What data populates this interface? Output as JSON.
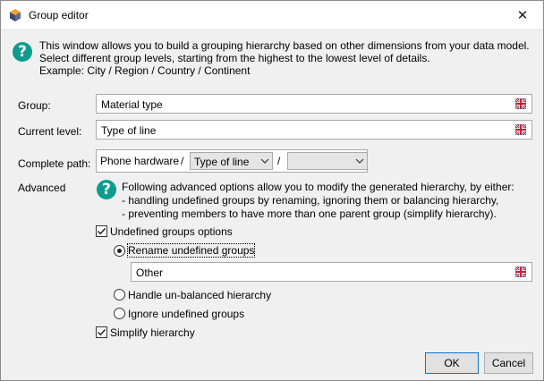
{
  "window": {
    "title": "Group editor",
    "close_glyph": "✕"
  },
  "info": {
    "line1": "This window allows you to build a grouping hierarchy based on other dimensions from your data model.",
    "line2": "Select different group levels, starting from the highest to the lowest level of details.",
    "line3": "Example: City / Region / Country / Continent"
  },
  "group": {
    "label": "Group:",
    "value": "Material type"
  },
  "current_level": {
    "label": "Current level:",
    "value": "Type of line"
  },
  "complete_path": {
    "label": "Complete path:",
    "root": "Phone hardware",
    "separator": "/",
    "level_select": "Type of line",
    "next_select": ""
  },
  "advanced": {
    "label": "Advanced",
    "line1": "Following advanced options allow you to modify the generated hierarchy, by either:",
    "line2": "- handling undefined groups by renaming, ignoring them or balancing hierarchy,",
    "line3": "- preventing members to have more than one parent group (simplify hierarchy)."
  },
  "undefined_groups": {
    "label": "Undefined groups options",
    "checked": true
  },
  "rename": {
    "label": "Rename undefined groups",
    "selected": true,
    "value": "Other"
  },
  "unbalanced": {
    "label": "Handle un-balanced hierarchy",
    "selected": false
  },
  "ignore": {
    "label": "Ignore undefined groups",
    "selected": false
  },
  "simplify": {
    "label": "Simplify hierarchy",
    "checked": true
  },
  "buttons": {
    "ok": "OK",
    "cancel": "Cancel"
  },
  "colors": {
    "help_icon": "#0d9b8f",
    "accent": "#0078d7"
  },
  "icons": [
    "app-cube-icon",
    "help-icon",
    "flag-icon",
    "chevron-down-icon",
    "checkmark-icon",
    "close-icon"
  ]
}
